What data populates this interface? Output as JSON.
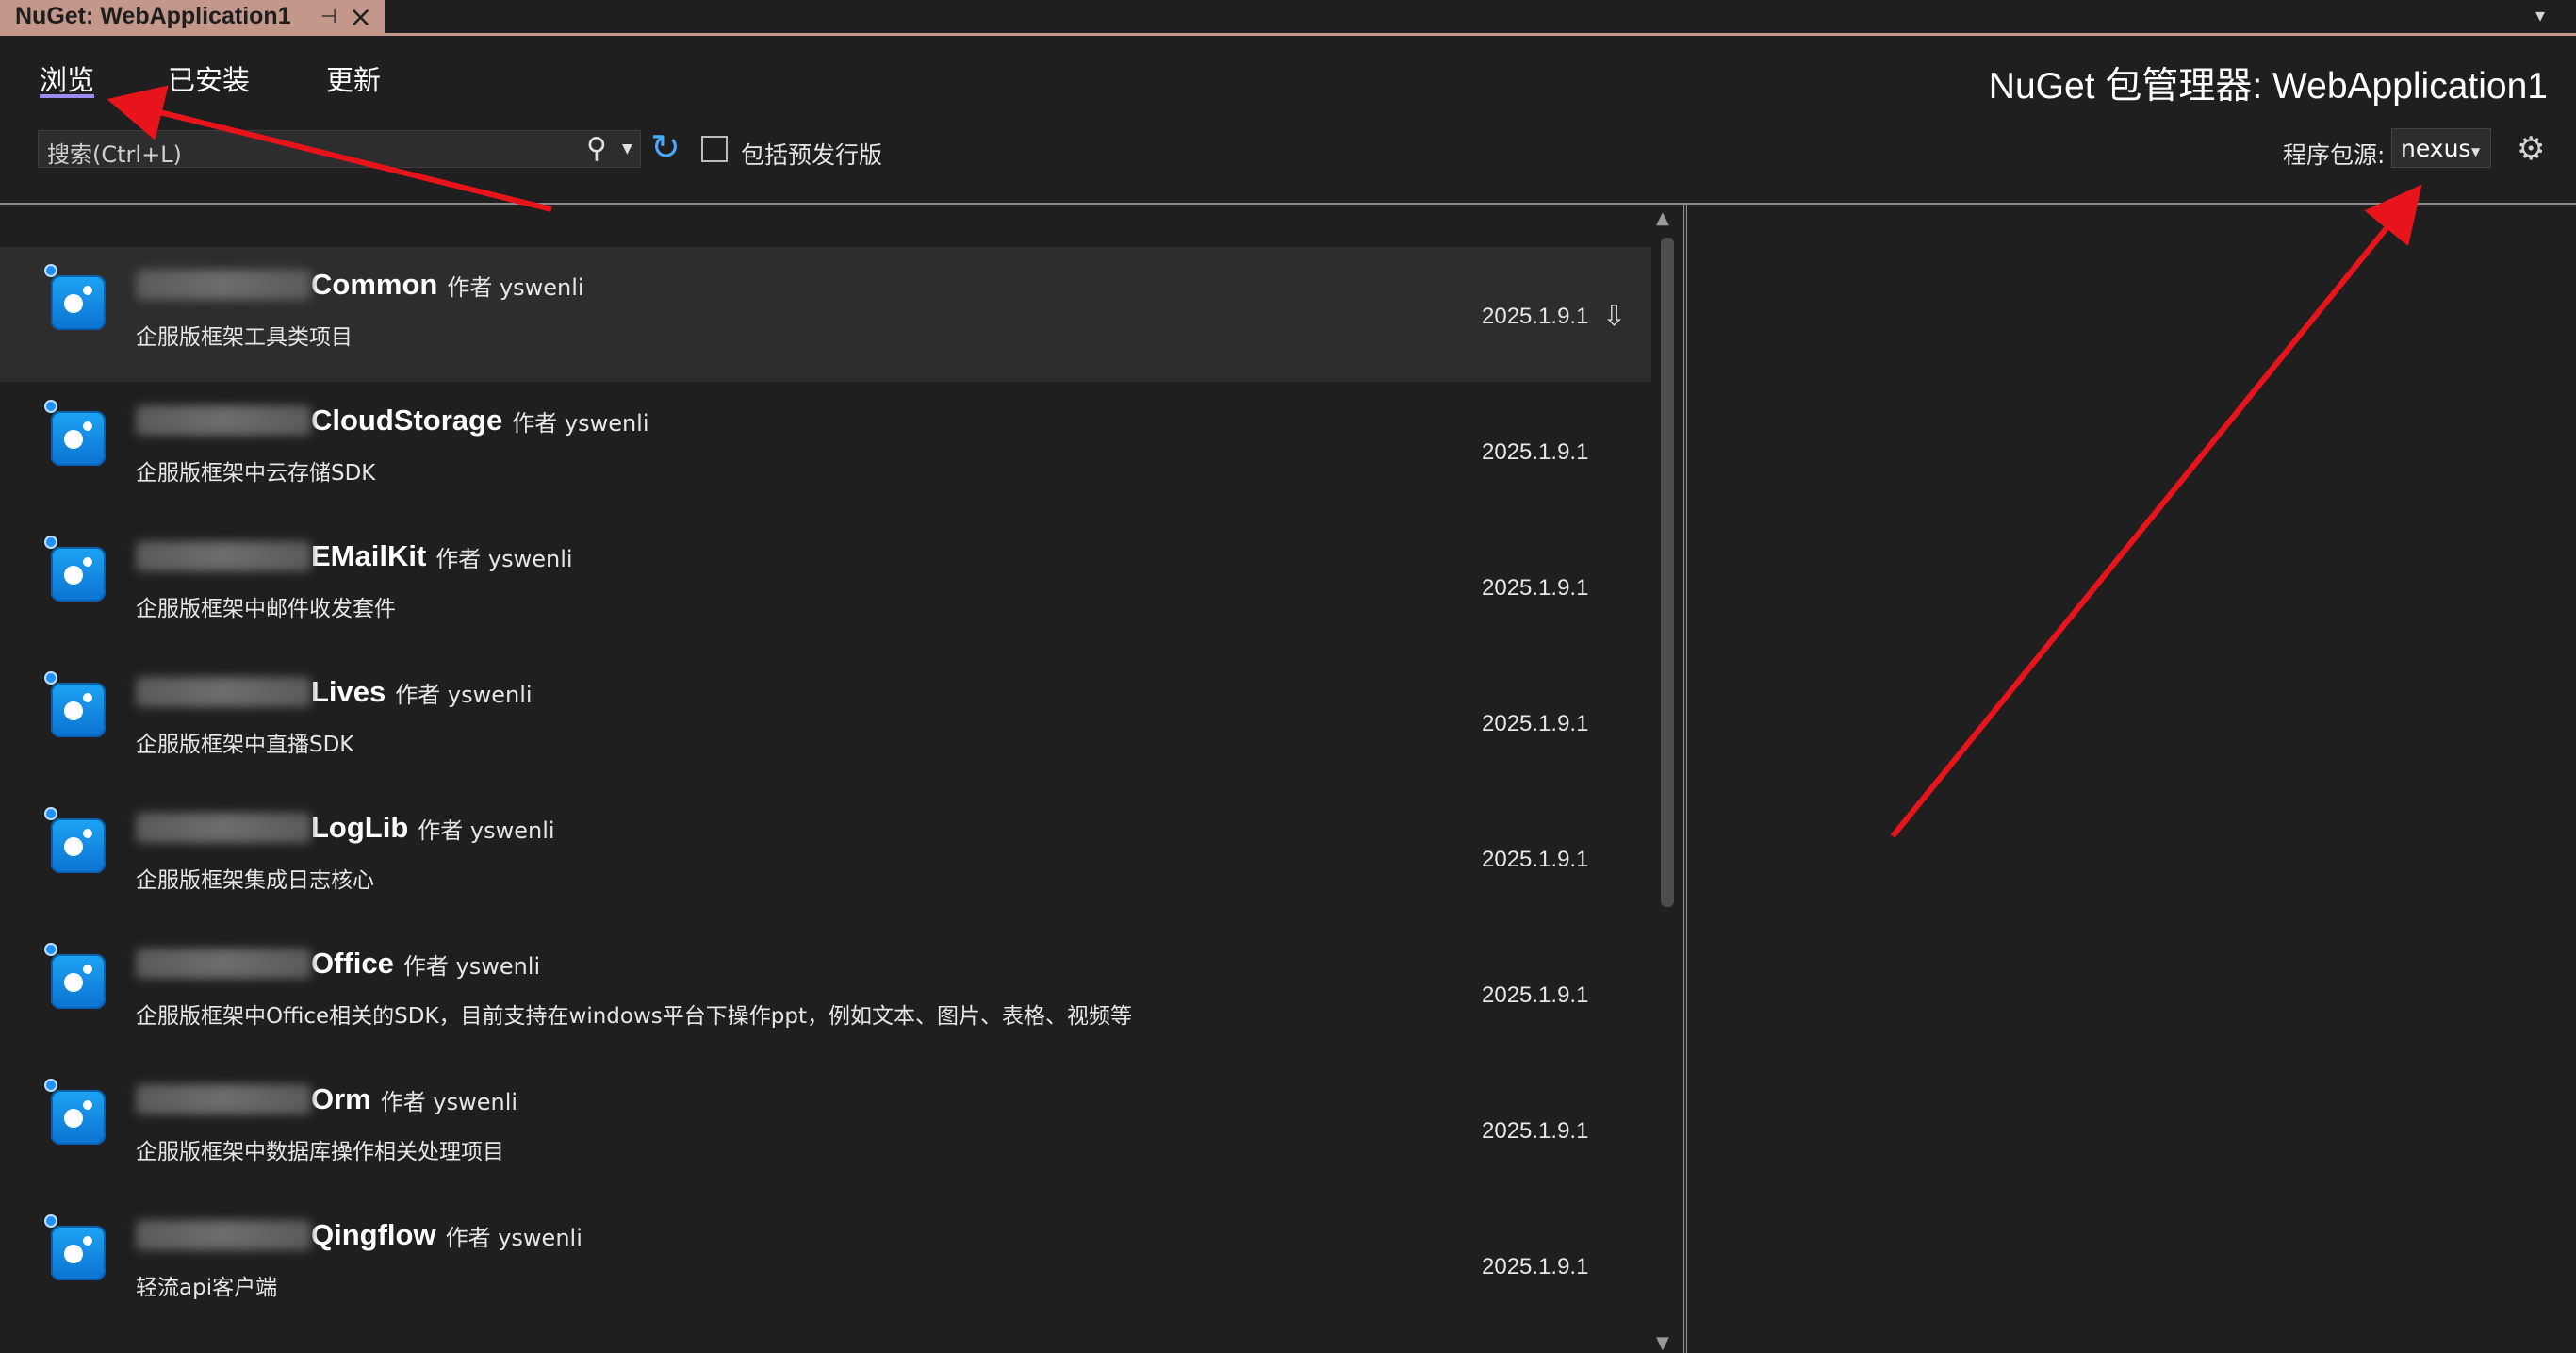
{
  "document_tab": {
    "title": "NuGet: WebApplication1",
    "pin_icon": "pin-icon",
    "close_icon": "close-icon"
  },
  "tabs": [
    {
      "label": "浏览",
      "active": true
    },
    {
      "label": "已安装",
      "active": false
    },
    {
      "label": "更新",
      "active": false
    }
  ],
  "manager_title": "NuGet 包管理器: WebApplication1",
  "search": {
    "placeholder": "搜索(Ctrl+L)",
    "icon": "search-icon"
  },
  "prerelease": {
    "label": "包括预发行版",
    "checked": false
  },
  "package_source": {
    "label": "程序包源:",
    "value": "nexus"
  },
  "colors": {
    "accent": "#9b8cf0",
    "tab_brand": "#c4978b",
    "annotation_arrow": "#e8141c",
    "refresh": "#4aa8ff"
  },
  "packages": [
    {
      "name": "Common",
      "author": "作者 yswenli",
      "description": "企服版框架工具类项目",
      "version": "2025.1.9.1",
      "selected": true
    },
    {
      "name": "CloudStorage",
      "author": "作者 yswenli",
      "description": "企服版框架中云存储SDK",
      "version": "2025.1.9.1"
    },
    {
      "name": "EMailKit",
      "author": "作者 yswenli",
      "description": "企服版框架中邮件收发套件",
      "version": "2025.1.9.1"
    },
    {
      "name": "Lives",
      "author": "作者 yswenli",
      "description": "企服版框架中直播SDK",
      "version": "2025.1.9.1"
    },
    {
      "name": "LogLib",
      "author": "作者 yswenli",
      "description": "企服版框架集成日志核心",
      "version": "2025.1.9.1"
    },
    {
      "name": "Office",
      "author": "作者 yswenli",
      "description": "企服版框架中Office相关的SDK，目前支持在windows平台下操作ppt，例如文本、图片、表格、视频等",
      "version": "2025.1.9.1"
    },
    {
      "name": "Orm",
      "author": "作者 yswenli",
      "description": "企服版框架中数据库操作相关处理项目",
      "version": "2025.1.9.1"
    },
    {
      "name": "Qingflow",
      "author": "作者 yswenli",
      "description": "轻流api客户端",
      "version": "2025.1.9.1"
    }
  ]
}
